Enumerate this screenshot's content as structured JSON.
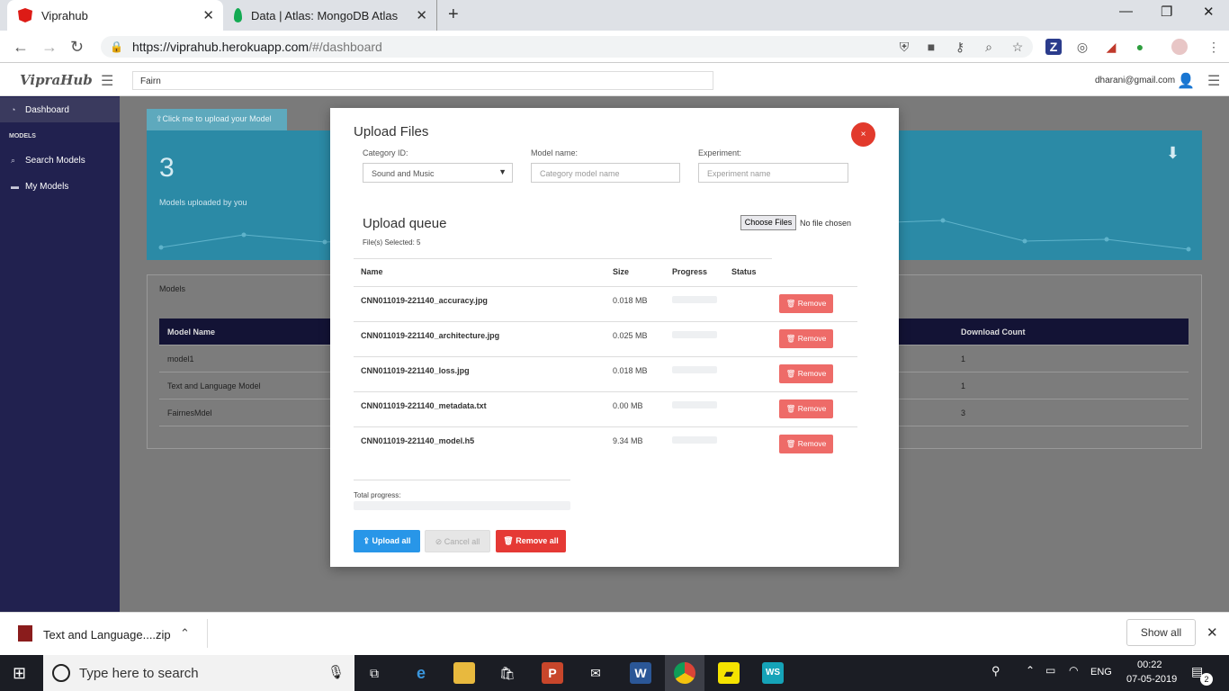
{
  "browser": {
    "tabs": [
      {
        "title": "Viprahub"
      },
      {
        "title": "Data | Atlas: MongoDB Atlas"
      }
    ],
    "url_host": "https://viprahub.herokuapp.com",
    "url_path": "/#/dashboard"
  },
  "app": {
    "brand": "VipraHub",
    "search_value": "Fairn",
    "user_email": "dharani@gmail.com"
  },
  "sidebar": {
    "items": [
      {
        "label": "Dashboard"
      },
      {
        "label": "MODELS"
      },
      {
        "label": "Search Models"
      },
      {
        "label": "My Models"
      }
    ]
  },
  "dashboard": {
    "upload_button": "Click me to upload your Model",
    "stat_value": "3",
    "stat_label": "Models uploaded by you",
    "models_panel_title": "Models",
    "table": {
      "headers": [
        "Model Name",
        "Download Count"
      ],
      "rows": [
        {
          "name": "model1",
          "downloads": "1"
        },
        {
          "name": "Text and Language Model",
          "downloads": "1"
        },
        {
          "name": "FairnesMdel",
          "downloads": "3"
        }
      ]
    }
  },
  "modal": {
    "title": "Upload Files",
    "close": "×",
    "fields": {
      "category_label": "Category ID:",
      "category_value": "Sound and Music",
      "model_label": "Model name:",
      "model_placeholder": "Category model name",
      "experiment_label": "Experiment:",
      "experiment_placeholder": "Experiment name"
    },
    "queue_title": "Upload queue",
    "files_selected": "File(s) Selected: 5",
    "choose_files": "Choose Files",
    "no_file": "No file chosen",
    "columns": [
      "Name",
      "Size",
      "Progress",
      "Status"
    ],
    "files": [
      {
        "name": "CNN011019-221140_accuracy.jpg",
        "size": "0.018 MB",
        "progress": 0
      },
      {
        "name": "CNN011019-221140_architecture.jpg",
        "size": "0.025 MB",
        "progress": 0
      },
      {
        "name": "CNN011019-221140_loss.jpg",
        "size": "0.018 MB",
        "progress": 0
      },
      {
        "name": "CNN011019-221140_metadata.txt",
        "size": "0.00 MB",
        "progress": 0
      },
      {
        "name": "CNN011019-221140_model.h5",
        "size": "9.34 MB",
        "progress": 0
      }
    ],
    "remove_label": "Remove",
    "total_progress_label": "Total progress:",
    "total_progress": 0,
    "buttons": {
      "upload_all": "Upload all",
      "cancel_all": "Cancel all",
      "remove_all": "Remove all"
    }
  },
  "downloads": {
    "file": "Text and Language....zip",
    "show_all": "Show all"
  },
  "taskbar": {
    "search_placeholder": "Type here to search",
    "lang": "ENG",
    "time": "00:22",
    "date": "07-05-2019",
    "notifications": "2"
  }
}
